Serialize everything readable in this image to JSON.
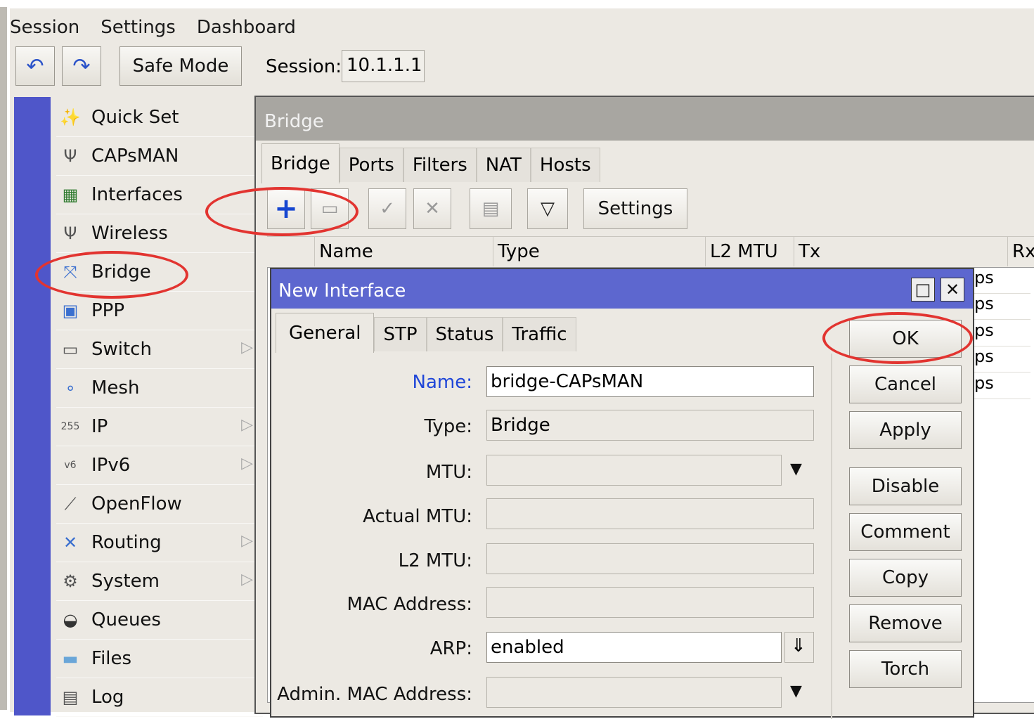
{
  "menubar": {
    "items": [
      "Session",
      "Settings",
      "Dashboard"
    ]
  },
  "toolbar": {
    "safe_mode": "Safe Mode",
    "session_label": "Session:",
    "session_value": "10.1.1.1"
  },
  "sidebar": {
    "items": [
      {
        "label": "Quick Set",
        "icon": "wand-icon"
      },
      {
        "label": "CAPsMAN",
        "icon": "antenna-icon"
      },
      {
        "label": "Interfaces",
        "icon": "network-card-icon"
      },
      {
        "label": "Wireless",
        "icon": "antenna-icon"
      },
      {
        "label": "Bridge",
        "icon": "bridge-icon"
      },
      {
        "label": "PPP",
        "icon": "ppp-icon"
      },
      {
        "label": "Switch",
        "icon": "switch-icon"
      },
      {
        "label": "Mesh",
        "icon": "mesh-icon"
      },
      {
        "label": "IP",
        "icon": "ip-icon"
      },
      {
        "label": "IPv6",
        "icon": "ipv6-icon"
      },
      {
        "label": "OpenFlow",
        "icon": "openflow-icon"
      },
      {
        "label": "Routing",
        "icon": "routing-icon"
      },
      {
        "label": "System",
        "icon": "gear-icon"
      },
      {
        "label": "Queues",
        "icon": "gauge-icon"
      },
      {
        "label": "Files",
        "icon": "folder-icon"
      },
      {
        "label": "Log",
        "icon": "log-icon"
      }
    ]
  },
  "bridge_window": {
    "title": "Bridge",
    "tabs": [
      "Bridge",
      "Ports",
      "Filters",
      "NAT",
      "Hosts"
    ],
    "settings_button": "Settings",
    "columns": [
      "Name",
      "Type",
      "L2 MTU",
      "Tx",
      "Rx"
    ],
    "rx_values": [
      "ps",
      "ps",
      "ps",
      "ps",
      "ps"
    ]
  },
  "dialog": {
    "title": "New Interface",
    "tabs": [
      "General",
      "STP",
      "Status",
      "Traffic"
    ],
    "fields": {
      "name_label": "Name:",
      "name_value": "bridge-CAPsMAN",
      "type_label": "Type:",
      "type_value": "Bridge",
      "mtu_label": "MTU:",
      "actual_mtu_label": "Actual MTU:",
      "l2mtu_label": "L2 MTU:",
      "mac_label": "MAC Address:",
      "arp_label": "ARP:",
      "arp_value": "enabled",
      "admin_mac_label": "Admin. MAC Address:"
    },
    "buttons": [
      "OK",
      "Cancel",
      "Apply",
      "Disable",
      "Comment",
      "Copy",
      "Remove",
      "Torch"
    ]
  },
  "colors": {
    "accent": "#5d67cf",
    "sidebar_stripe": "#4f56c9",
    "highlight": "#e23430",
    "name_label": "#1f46d8"
  }
}
